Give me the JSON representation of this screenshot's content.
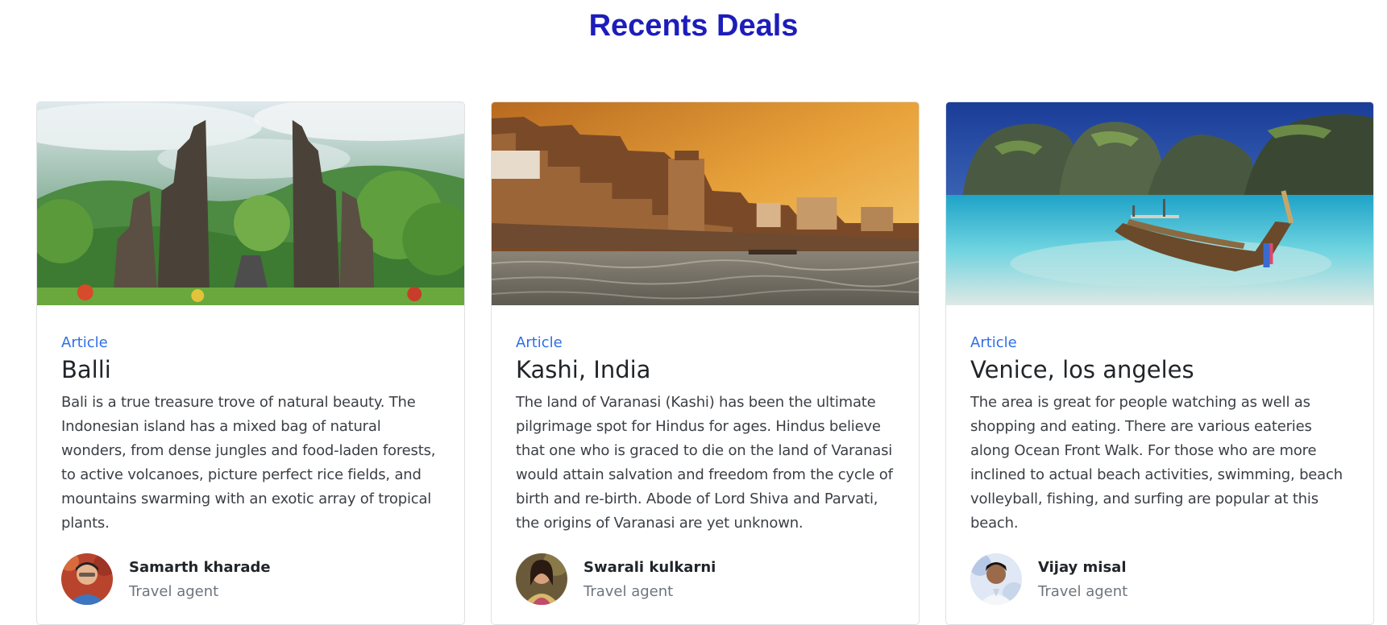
{
  "page": {
    "heading": "Recents Deals"
  },
  "cards": [
    {
      "image_icon": "bali-temple-gate-photo",
      "tag": "Article",
      "title": "Balli",
      "description": "Bali is a true treasure trove of natural beauty. The Indonesian island has a mixed bag of natural wonders, from dense jungles and food-laden forests, to active volcanoes, picture perfect rice fields, and mountains swarming with an exotic array of tropical plants.",
      "author": {
        "name": "Samarth kharade",
        "role": "Travel agent"
      }
    },
    {
      "image_icon": "varanasi-ghats-photo",
      "tag": "Article",
      "title": "Kashi, India",
      "description": "The land of Varanasi (Kashi) has been the ultimate pilgrimage spot for Hindus for ages. Hindus believe that one who is graced to die on the land of Varanasi would attain salvation and freedom from the cycle of birth and re-birth. Abode of Lord Shiva and Parvati, the origins of Varanasi are yet unknown.",
      "author": {
        "name": "Swarali kulkarni",
        "role": "Travel agent"
      }
    },
    {
      "image_icon": "beach-longtail-boat-photo",
      "tag": "Article",
      "title": "Venice, los angeles",
      "description": "The area is great for people watching as well as shopping and eating. There are various eateries along Ocean Front Walk. For those who are more inclined to actual beach activities, swimming, beach volleyball, fishing, and surfing are popular at this beach.",
      "author": {
        "name": "Vijay misal",
        "role": "Travel agent"
      }
    }
  ],
  "colors": {
    "heading": "#1d1dbb",
    "tag": "#2f6fe4",
    "muted": "#6c757d"
  }
}
